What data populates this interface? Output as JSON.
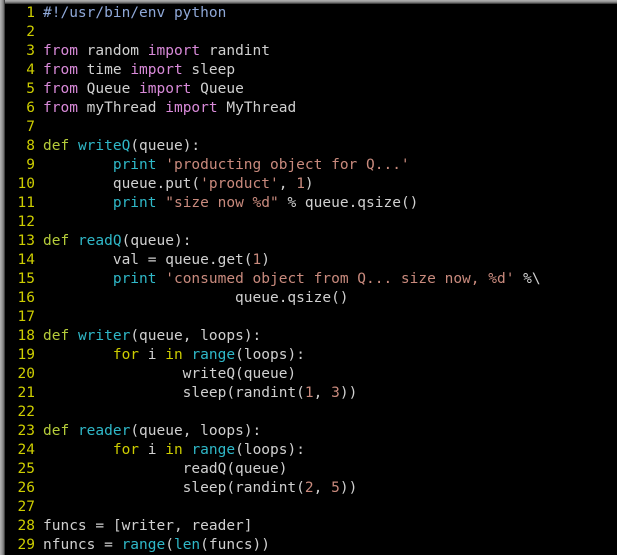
{
  "editor": {
    "language": "python",
    "line_count": 29,
    "background_color": "#000000",
    "gutter_color": "#cdcd00",
    "frame_color": "#9a9a9a"
  },
  "palette": {
    "comment": "#8fa8d8",
    "import_keyword": "#d98ad9",
    "def_keyword": "#b5cc3a",
    "function_name": "#2fb8c8",
    "builtin": "#2fb8c8",
    "control_keyword": "#cdcd00",
    "string": "#c98a7d",
    "number": "#c98a7d",
    "plain": "#d0d0d0"
  },
  "lines": [
    {
      "number": "1",
      "tokens": [
        {
          "t": "#!/usr/bin/env python",
          "c": "tok-comment"
        }
      ]
    },
    {
      "number": "2",
      "tokens": []
    },
    {
      "number": "3",
      "tokens": [
        {
          "t": "from",
          "c": "tok-import"
        },
        {
          "t": " random ",
          "c": "tok-module"
        },
        {
          "t": "import",
          "c": "tok-import"
        },
        {
          "t": " randint",
          "c": "tok-module"
        }
      ]
    },
    {
      "number": "4",
      "tokens": [
        {
          "t": "from",
          "c": "tok-import"
        },
        {
          "t": " time ",
          "c": "tok-module"
        },
        {
          "t": "import",
          "c": "tok-import"
        },
        {
          "t": " sleep",
          "c": "tok-module"
        }
      ]
    },
    {
      "number": "5",
      "tokens": [
        {
          "t": "from",
          "c": "tok-import"
        },
        {
          "t": " Queue ",
          "c": "tok-module"
        },
        {
          "t": "import",
          "c": "tok-import"
        },
        {
          "t": " Queue",
          "c": "tok-module"
        }
      ]
    },
    {
      "number": "6",
      "tokens": [
        {
          "t": "from",
          "c": "tok-import"
        },
        {
          "t": " myThread ",
          "c": "tok-module"
        },
        {
          "t": "import",
          "c": "tok-import"
        },
        {
          "t": " MyThread",
          "c": "tok-module"
        }
      ]
    },
    {
      "number": "7",
      "tokens": []
    },
    {
      "number": "8",
      "tokens": [
        {
          "t": "def",
          "c": "tok-def"
        },
        {
          "t": " ",
          "c": "tok-plain"
        },
        {
          "t": "writeQ",
          "c": "tok-funcname"
        },
        {
          "t": "(queue):",
          "c": "tok-plain"
        }
      ]
    },
    {
      "number": "9",
      "tokens": [
        {
          "t": "        ",
          "c": "tok-plain"
        },
        {
          "t": "print",
          "c": "tok-builtin"
        },
        {
          "t": " ",
          "c": "tok-plain"
        },
        {
          "t": "'producting object for Q...'",
          "c": "tok-string"
        }
      ]
    },
    {
      "number": "10",
      "tokens": [
        {
          "t": "        queue.put(",
          "c": "tok-plain"
        },
        {
          "t": "'product'",
          "c": "tok-string"
        },
        {
          "t": ", ",
          "c": "tok-plain"
        },
        {
          "t": "1",
          "c": "tok-number"
        },
        {
          "t": ")",
          "c": "tok-plain"
        }
      ]
    },
    {
      "number": "11",
      "tokens": [
        {
          "t": "        ",
          "c": "tok-plain"
        },
        {
          "t": "print",
          "c": "tok-builtin"
        },
        {
          "t": " ",
          "c": "tok-plain"
        },
        {
          "t": "\"size now %d\"",
          "c": "tok-string"
        },
        {
          "t": " % queue.qsize()",
          "c": "tok-plain"
        }
      ]
    },
    {
      "number": "12",
      "tokens": []
    },
    {
      "number": "13",
      "tokens": [
        {
          "t": "def",
          "c": "tok-def"
        },
        {
          "t": " ",
          "c": "tok-plain"
        },
        {
          "t": "readQ",
          "c": "tok-funcname"
        },
        {
          "t": "(queue):",
          "c": "tok-plain"
        }
      ]
    },
    {
      "number": "14",
      "tokens": [
        {
          "t": "        val = queue.get(",
          "c": "tok-plain"
        },
        {
          "t": "1",
          "c": "tok-number"
        },
        {
          "t": ")",
          "c": "tok-plain"
        }
      ]
    },
    {
      "number": "15",
      "tokens": [
        {
          "t": "        ",
          "c": "tok-plain"
        },
        {
          "t": "print",
          "c": "tok-builtin"
        },
        {
          "t": " ",
          "c": "tok-plain"
        },
        {
          "t": "'consumed object from Q... size now, %d'",
          "c": "tok-string"
        },
        {
          "t": " %\\",
          "c": "tok-plain"
        }
      ]
    },
    {
      "number": "16",
      "tokens": [
        {
          "t": "                      queue.qsize()",
          "c": "tok-plain"
        }
      ]
    },
    {
      "number": "17",
      "tokens": []
    },
    {
      "number": "18",
      "tokens": [
        {
          "t": "def",
          "c": "tok-def"
        },
        {
          "t": " ",
          "c": "tok-plain"
        },
        {
          "t": "writer",
          "c": "tok-funcname"
        },
        {
          "t": "(queue, loops):",
          "c": "tok-plain"
        }
      ]
    },
    {
      "number": "19",
      "tokens": [
        {
          "t": "        ",
          "c": "tok-plain"
        },
        {
          "t": "for",
          "c": "tok-keyword"
        },
        {
          "t": " i ",
          "c": "tok-plain"
        },
        {
          "t": "in",
          "c": "tok-keyword"
        },
        {
          "t": " ",
          "c": "tok-plain"
        },
        {
          "t": "range",
          "c": "tok-builtin"
        },
        {
          "t": "(loops):",
          "c": "tok-plain"
        }
      ]
    },
    {
      "number": "20",
      "tokens": [
        {
          "t": "                writeQ(queue)",
          "c": "tok-plain"
        }
      ]
    },
    {
      "number": "21",
      "tokens": [
        {
          "t": "                sleep(randint(",
          "c": "tok-plain"
        },
        {
          "t": "1",
          "c": "tok-number"
        },
        {
          "t": ", ",
          "c": "tok-plain"
        },
        {
          "t": "3",
          "c": "tok-number"
        },
        {
          "t": "))",
          "c": "tok-plain"
        }
      ]
    },
    {
      "number": "22",
      "tokens": []
    },
    {
      "number": "23",
      "tokens": [
        {
          "t": "def",
          "c": "tok-def"
        },
        {
          "t": " ",
          "c": "tok-plain"
        },
        {
          "t": "reader",
          "c": "tok-funcname"
        },
        {
          "t": "(queue, loops):",
          "c": "tok-plain"
        }
      ]
    },
    {
      "number": "24",
      "tokens": [
        {
          "t": "        ",
          "c": "tok-plain"
        },
        {
          "t": "for",
          "c": "tok-keyword"
        },
        {
          "t": " i ",
          "c": "tok-plain"
        },
        {
          "t": "in",
          "c": "tok-keyword"
        },
        {
          "t": " ",
          "c": "tok-plain"
        },
        {
          "t": "range",
          "c": "tok-builtin"
        },
        {
          "t": "(loops):",
          "c": "tok-plain"
        }
      ]
    },
    {
      "number": "25",
      "tokens": [
        {
          "t": "                readQ(queue)",
          "c": "tok-plain"
        }
      ]
    },
    {
      "number": "26",
      "tokens": [
        {
          "t": "                sleep(randint(",
          "c": "tok-plain"
        },
        {
          "t": "2",
          "c": "tok-number"
        },
        {
          "t": ", ",
          "c": "tok-plain"
        },
        {
          "t": "5",
          "c": "tok-number"
        },
        {
          "t": "))",
          "c": "tok-plain"
        }
      ]
    },
    {
      "number": "27",
      "tokens": []
    },
    {
      "number": "28",
      "tokens": [
        {
          "t": "funcs = [writer, reader]",
          "c": "tok-plain"
        }
      ]
    },
    {
      "number": "29",
      "tokens": [
        {
          "t": "nfuncs = ",
          "c": "tok-plain"
        },
        {
          "t": "range",
          "c": "tok-builtin"
        },
        {
          "t": "(",
          "c": "tok-plain"
        },
        {
          "t": "len",
          "c": "tok-builtin"
        },
        {
          "t": "(funcs))",
          "c": "tok-plain"
        }
      ]
    }
  ]
}
